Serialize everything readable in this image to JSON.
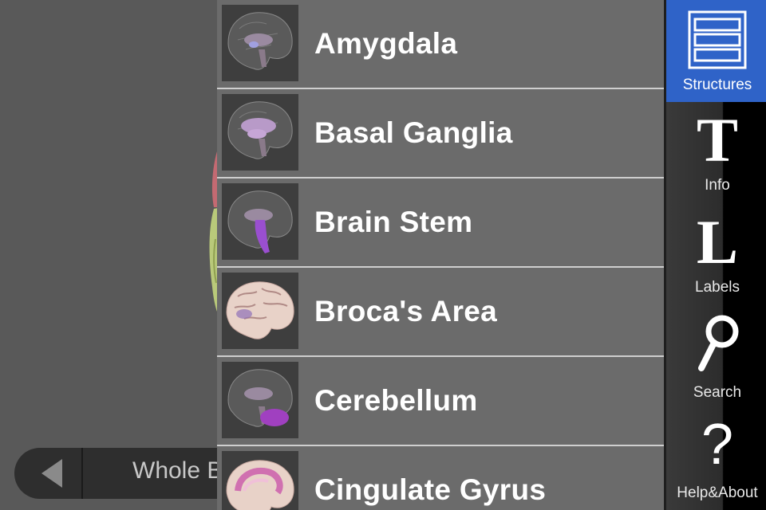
{
  "viewer": {
    "nav_title": "Whole Brain"
  },
  "list": {
    "items": [
      {
        "label": "Amygdala",
        "thumb_icon": "amygdala-thumbnail"
      },
      {
        "label": "Basal Ganglia",
        "thumb_icon": "basal-ganglia-thumbnail"
      },
      {
        "label": "Brain Stem",
        "thumb_icon": "brain-stem-thumbnail"
      },
      {
        "label": "Broca's Area",
        "thumb_icon": "brocas-area-thumbnail"
      },
      {
        "label": "Cerebellum",
        "thumb_icon": "cerebellum-thumbnail"
      },
      {
        "label": "Cingulate Gyrus",
        "thumb_icon": "cingulate-gyrus-thumbnail"
      }
    ]
  },
  "toolbar": {
    "structures_label": "Structures",
    "info_label": "Info",
    "labels_label": "Labels",
    "search_label": "Search",
    "help_label": "Help&About",
    "info_glyph": "T",
    "labels_glyph": "L",
    "help_glyph": "?",
    "selected": "Structures",
    "selected_color": "#2f63c8"
  }
}
